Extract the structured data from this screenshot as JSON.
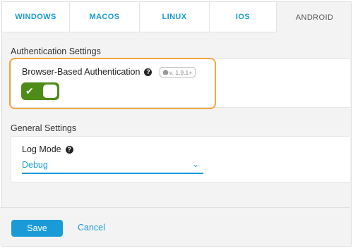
{
  "tabs": [
    {
      "label": "WINDOWS"
    },
    {
      "label": "MACOS"
    },
    {
      "label": "LINUX"
    },
    {
      "label": "IOS"
    },
    {
      "label": "ANDROID",
      "active": true
    }
  ],
  "auth_section": {
    "title": "Authentication Settings",
    "field_label": "Browser-Based Authentication",
    "help_icon": "question-circle-icon",
    "version_badge": "v. 1.9.1+",
    "version_icon": "android-icon",
    "toggle_on": true,
    "highlight_color": "#f5a540"
  },
  "general_section": {
    "title": "General Settings",
    "log_mode_label": "Log Mode",
    "help_icon": "question-circle-icon",
    "log_mode_value": "Debug"
  },
  "footer": {
    "save_label": "Save",
    "cancel_label": "Cancel"
  },
  "colors": {
    "accent": "#1a9bd7",
    "toggle_on": "#4e8c18",
    "highlight": "#f5a540",
    "background": "#f3f3f3"
  }
}
